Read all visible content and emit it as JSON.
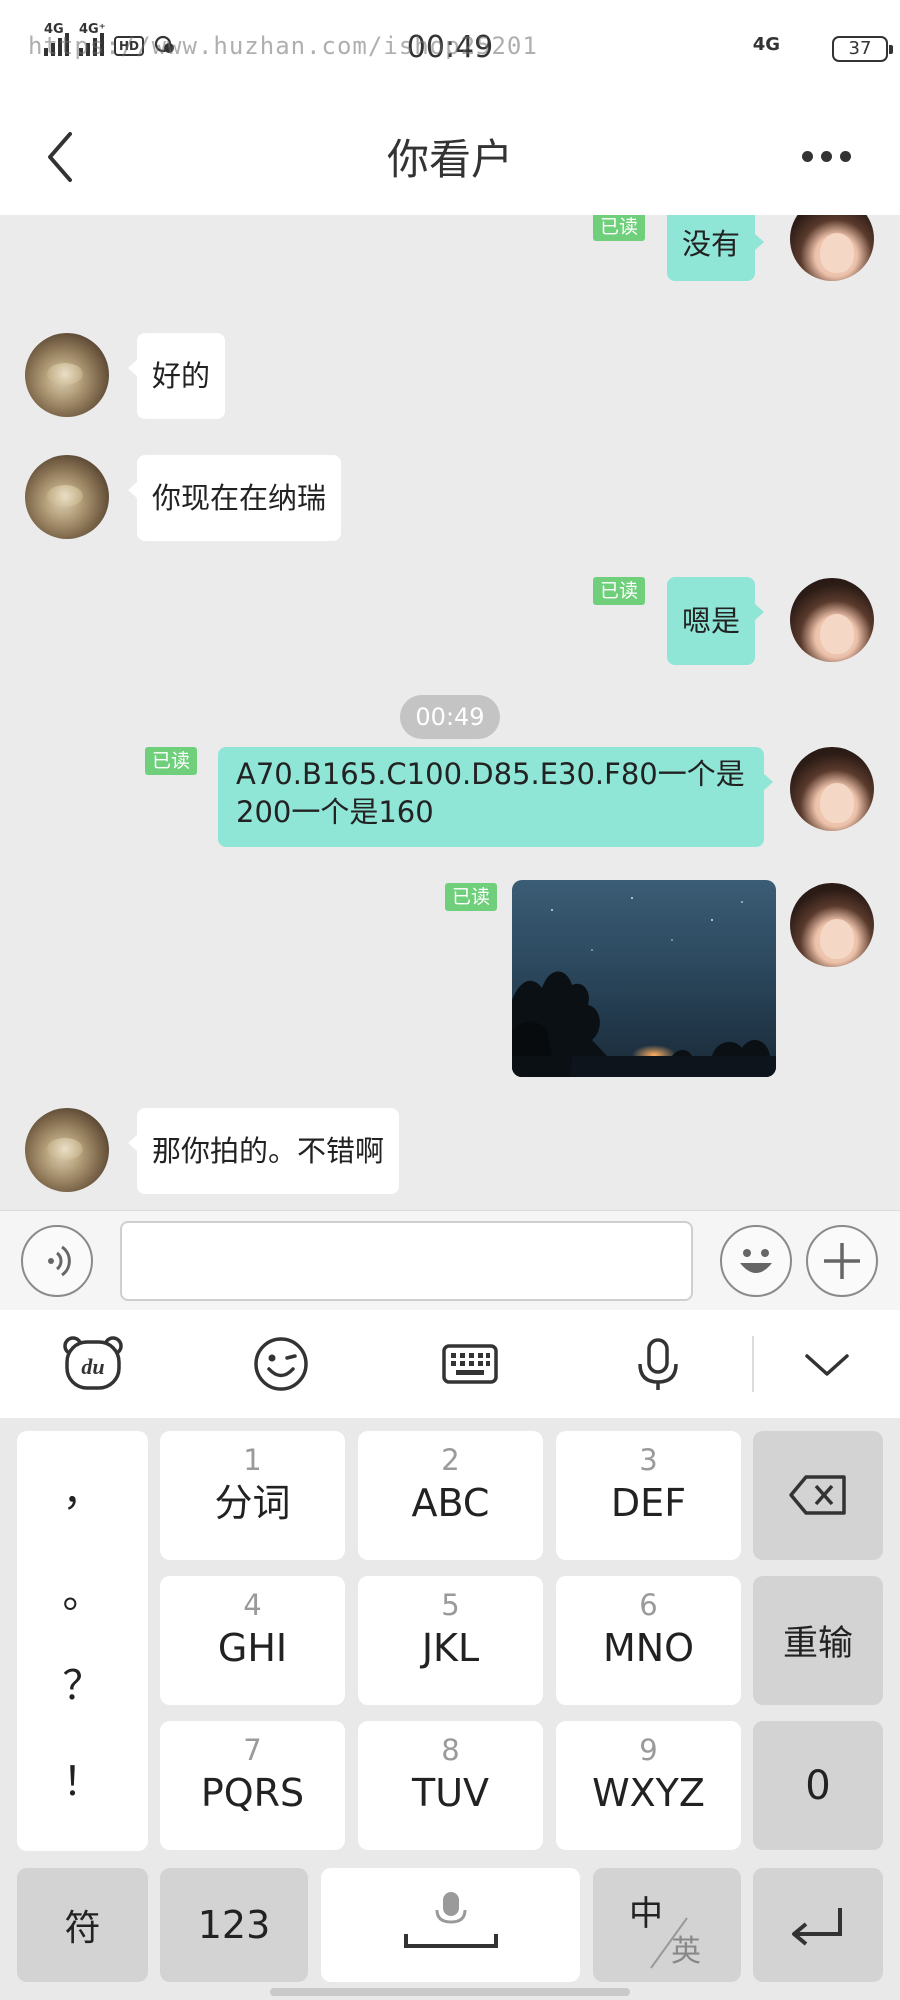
{
  "status_bar": {
    "watermark": "https://www.huzhan.com/ishop25201",
    "network_1": "4G",
    "network_2": "4G⁺",
    "hd": "HD",
    "time": "00:49",
    "network_right": "4G",
    "battery": "37"
  },
  "header": {
    "title": "你看户"
  },
  "read_label": "已读",
  "messages": [
    {
      "side": "right",
      "text": "没有",
      "read": true
    },
    {
      "side": "left",
      "text": "好的"
    },
    {
      "side": "left",
      "text": "你现在在纳瑞"
    },
    {
      "side": "right",
      "text": "嗯是",
      "read": true
    },
    {
      "timestamp": "00:49"
    },
    {
      "side": "right",
      "text": "A70.B165.C100.D85.E30.F80一个是200一个是160",
      "read": true
    },
    {
      "side": "right",
      "type": "image",
      "read": true
    },
    {
      "side": "left",
      "text": "那你拍的。不错啊"
    }
  ],
  "input": {
    "value": "",
    "placeholder": ""
  },
  "keyboard": {
    "punctuation": [
      "，",
      "。",
      "？",
      "！"
    ],
    "keys": [
      {
        "num": "1",
        "label": "分词"
      },
      {
        "num": "2",
        "label": "ABC"
      },
      {
        "num": "3",
        "label": "DEF"
      },
      {
        "num": "4",
        "label": "GHI"
      },
      {
        "num": "5",
        "label": "JKL"
      },
      {
        "num": "6",
        "label": "MNO"
      },
      {
        "num": "7",
        "label": "PQRS"
      },
      {
        "num": "8",
        "label": "TUV"
      },
      {
        "num": "9",
        "label": "WXYZ"
      }
    ],
    "reinput": "重输",
    "zero": "0",
    "symbols": "符",
    "numbers": "123",
    "lang_zh": "中",
    "lang_en": "英"
  },
  "icons": {
    "back": "chevron-left-icon",
    "more": "more-dots-icon",
    "voice": "voice-wave-icon",
    "emoji": "emoji-icon",
    "add": "plus-icon",
    "kb_logo": "baidu-du-icon",
    "kb_emoji": "smile-icon",
    "kb_layout": "keyboard-icon",
    "kb_mic": "mic-icon",
    "kb_collapse": "chevron-down-icon",
    "backspace": "backspace-icon",
    "space": "space-mic-icon",
    "enter": "enter-icon"
  },
  "colors": {
    "bubble_sent": "#8fe5d6",
    "bubble_received": "#ffffff",
    "read_tag": "#6fcf7b",
    "chat_background": "#ebebeb"
  }
}
